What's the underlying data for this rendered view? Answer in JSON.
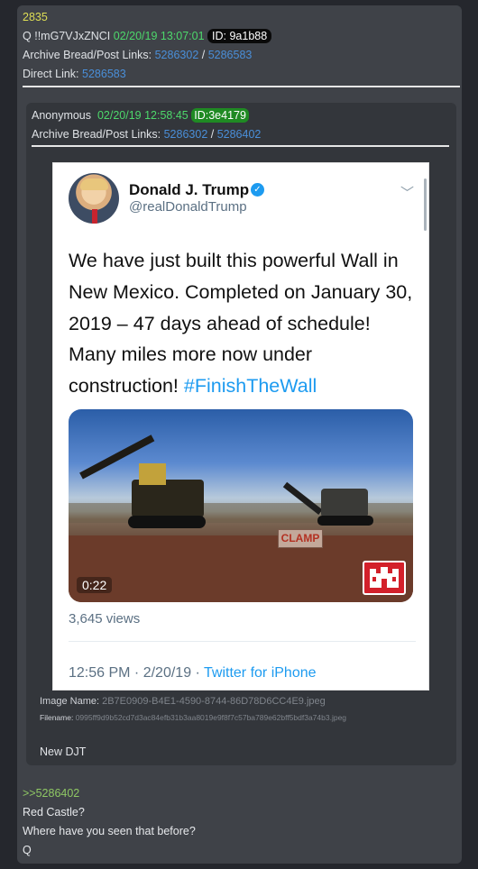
{
  "post": {
    "number": "2835",
    "author": "Q",
    "tripcode": "!!mG7VJxZNCI",
    "timestamp": "02/20/19 13:07:01",
    "id_label": "ID: 9a1b88",
    "archive_label": "Archive Bread/Post Links:",
    "archive_link1": "5286302",
    "archive_slash": " / ",
    "archive_link2": "5286583",
    "direct_label": "Direct Link:",
    "direct_link": "5286583"
  },
  "quoted": {
    "author": "Anonymous",
    "timestamp": "02/20/19 12:58:45",
    "id_label": "ID:3e4179",
    "archive_label": "Archive Bread/Post Links:",
    "archive_link1": "5286302",
    "archive_slash": " / ",
    "archive_link2": "5286402",
    "tweet": {
      "name": "Donald J. Trump",
      "verified_icon": "verified-badge-icon",
      "handle": "@realDonaldTrump",
      "text": "We have just built this powerful Wall in New Mexico. Completed on January 30, 2019 – 47 days ahead of schedule! Many miles more now under construction!",
      "hashtag": "#FinishTheWall",
      "video_sign": "CLAMP",
      "video_duration": "0:22",
      "views": "3,645 views",
      "time_date": "12:56 PM · 2/20/19 · ",
      "source": "Twitter for iPhone"
    },
    "image_name_label": "Image Name:",
    "image_name": "2B7E0909-B4E1-4590-8744-86D78D6CC4E9.jpeg",
    "filename_label": "Filename:",
    "filename": "0995ff9d9b52cd7d3ac84efb31b3aa8019e9f8f7c57ba789e62bff5bdf3a74b3.jpeg",
    "comment": "New DJT"
  },
  "reply": {
    "quote_link": ">>5286402",
    "lines": [
      "Red Castle?",
      "Where have you seen that before?",
      "Q"
    ]
  },
  "colors": {
    "background": "#25272d",
    "post_bg": "#3f4248",
    "quote_bg": "#33363b",
    "number_yellow": "#dede55",
    "timestamp_green": "#4dd86b",
    "link_blue": "#4a8fd9",
    "twitter_blue": "#1d9bf0"
  }
}
